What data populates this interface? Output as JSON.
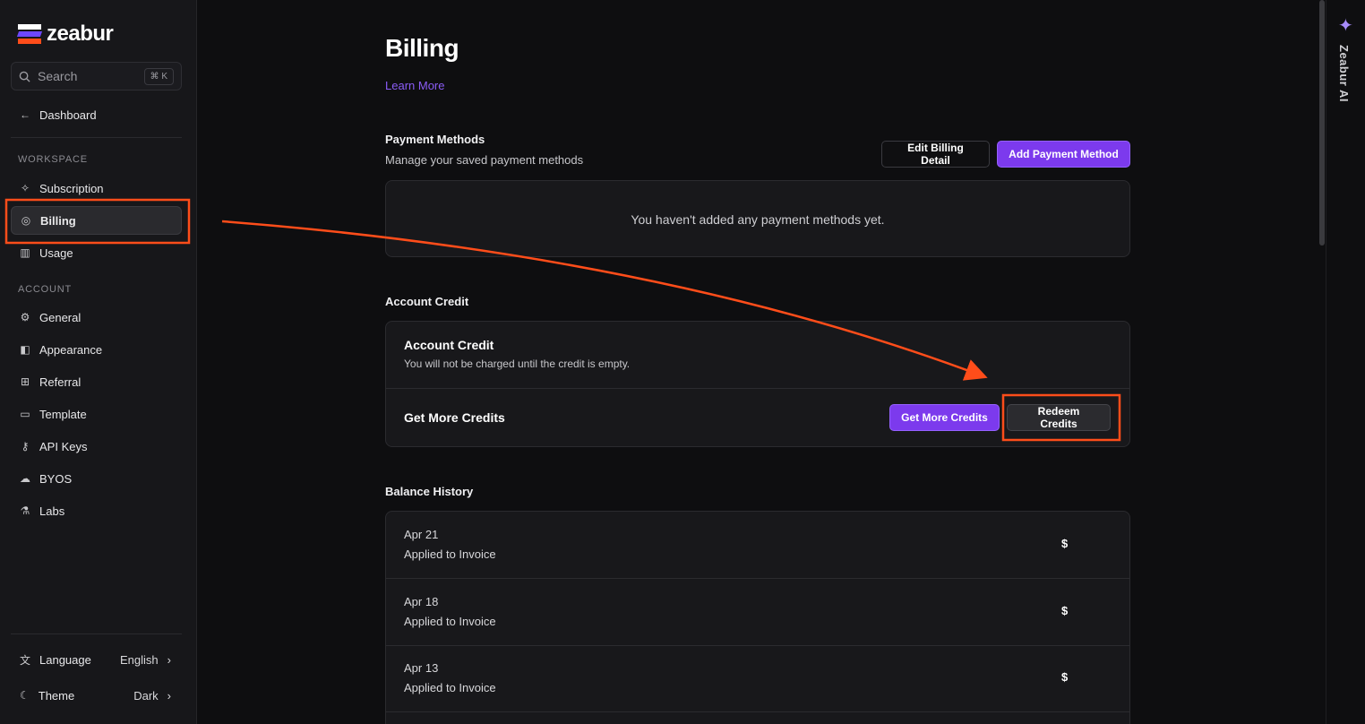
{
  "brand": {
    "name": "zeabur"
  },
  "search": {
    "label": "Search",
    "shortcut": "⌘ K"
  },
  "sidebar": {
    "dashboard": "Dashboard",
    "workspace_label": "WORKSPACE",
    "workspace_items": [
      {
        "label": "Subscription",
        "icon": "sparkle-icon"
      },
      {
        "label": "Billing",
        "icon": "credit-icon"
      },
      {
        "label": "Usage",
        "icon": "chart-icon"
      }
    ],
    "account_label": "ACCOUNT",
    "account_items": [
      {
        "label": "General",
        "icon": "gear-icon"
      },
      {
        "label": "Appearance",
        "icon": "palette-icon"
      },
      {
        "label": "Referral",
        "icon": "gift-icon"
      },
      {
        "label": "Template",
        "icon": "folder-icon"
      },
      {
        "label": "API Keys",
        "icon": "key-icon"
      },
      {
        "label": "BYOS",
        "icon": "cloud-icon"
      },
      {
        "label": "Labs",
        "icon": "flask-icon"
      }
    ],
    "language": {
      "label": "Language",
      "value": "English"
    },
    "theme": {
      "label": "Theme",
      "value": "Dark"
    }
  },
  "page": {
    "title": "Billing",
    "learn_more": "Learn More"
  },
  "payment": {
    "title": "Payment Methods",
    "subtitle": "Manage your saved payment methods",
    "edit_button": "Edit Billing Detail",
    "add_button": "Add Payment Method",
    "empty": "You haven't added any payment methods yet."
  },
  "credit": {
    "section_title": "Account Credit",
    "card_title": "Account Credit",
    "card_subtitle": "You will not be charged until the credit is empty.",
    "more_label": "Get More Credits",
    "get_more_button": "Get More Credits",
    "redeem_button": "Redeem Credits"
  },
  "history": {
    "title": "Balance History",
    "rows": [
      {
        "date": "Apr 21",
        "desc": "Applied to Invoice",
        "amount": "$"
      },
      {
        "date": "Apr 18",
        "desc": "Applied to Invoice",
        "amount": "$"
      },
      {
        "date": "Apr 13",
        "desc": "Applied to Invoice",
        "amount": "$"
      }
    ]
  },
  "ai_rail": {
    "label": "Zeabur AI"
  },
  "colors": {
    "accent": "#7c3aed",
    "annotation": "#ff4d1a"
  }
}
